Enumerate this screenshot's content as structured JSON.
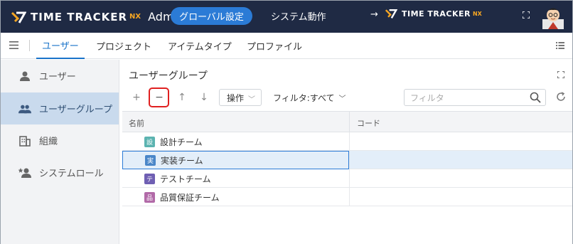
{
  "header": {
    "logo_text": "TIME TRACKER",
    "logo_nx": "NX",
    "admin_label": "Admin",
    "global_settings": "グローバル設定",
    "system_operation": "システム動作",
    "arrow": "→",
    "link_logo_text": "TIME TRACKER",
    "link_logo_nx": "NX"
  },
  "nav": {
    "tabs": [
      {
        "label": "ユーザー",
        "active": true
      },
      {
        "label": "プロジェクト",
        "active": false
      },
      {
        "label": "アイテムタイプ",
        "active": false
      },
      {
        "label": "プロファイル",
        "active": false
      }
    ]
  },
  "sidebar": {
    "items": [
      {
        "label": "ユーザー",
        "icon": "person-icon",
        "active": false
      },
      {
        "label": "ユーザーグループ",
        "icon": "people-icon",
        "active": true
      },
      {
        "label": "組織",
        "icon": "building-icon",
        "active": false
      },
      {
        "label": "システムロール",
        "icon": "person-star-icon",
        "active": false
      }
    ]
  },
  "main": {
    "title": "ユーザーグループ",
    "toolbar": {
      "add": "+",
      "remove": "−",
      "up": "↑",
      "down": "↓",
      "operation_label": "操作",
      "filter_label": "フィルタ:すべて",
      "search_placeholder": "フィルタ"
    },
    "grid": {
      "columns": [
        "名前",
        "コード"
      ],
      "rows": [
        {
          "badge": "設",
          "badge_color": "#5bb3b0",
          "name": "設計チーム",
          "code": "",
          "selected": false
        },
        {
          "badge": "実",
          "badge_color": "#4a86c8",
          "name": "実装チーム",
          "code": "",
          "selected": true
        },
        {
          "badge": "テ",
          "badge_color": "#6f5fb3",
          "name": "テストチーム",
          "code": "",
          "selected": false
        },
        {
          "badge": "品",
          "badge_color": "#b26aa8",
          "name": "品質保証チーム",
          "code": "",
          "selected": false
        }
      ]
    }
  },
  "colors": {
    "header_bg": "#1f2a44",
    "accent": "#2b7bd6",
    "logo_accent": "#f5a623",
    "highlight_box": "#e02020"
  }
}
